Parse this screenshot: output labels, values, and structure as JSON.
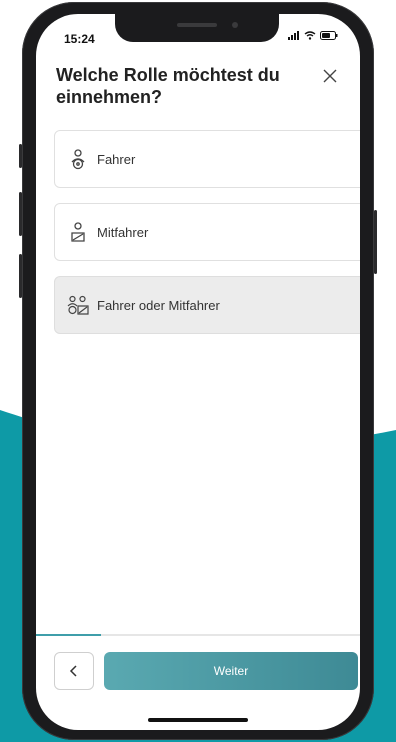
{
  "status_bar": {
    "time": "15:24"
  },
  "title": "Welche Rolle möchtest du einnehmen?",
  "options": [
    {
      "label": "Fahrer",
      "icon": "driver-icon",
      "selected": false
    },
    {
      "label": "Mitfahrer",
      "icon": "passenger-icon",
      "selected": false
    },
    {
      "label": "Fahrer oder Mitfahrer",
      "icon": "driver-or-passenger-icon",
      "selected": true
    }
  ],
  "progress": {
    "fraction": 0.2
  },
  "footer": {
    "next_label": "Weiter"
  },
  "colors": {
    "accent": "#3f9eaa",
    "button_start": "#5aa9b1",
    "button_end": "#3e8a95",
    "background_wave": "#0e9aa6",
    "selected_bg": "#ececec"
  },
  "icons": [
    "close-icon",
    "chevron-left-icon",
    "wifi-icon",
    "signal-icon",
    "battery-icon"
  ]
}
